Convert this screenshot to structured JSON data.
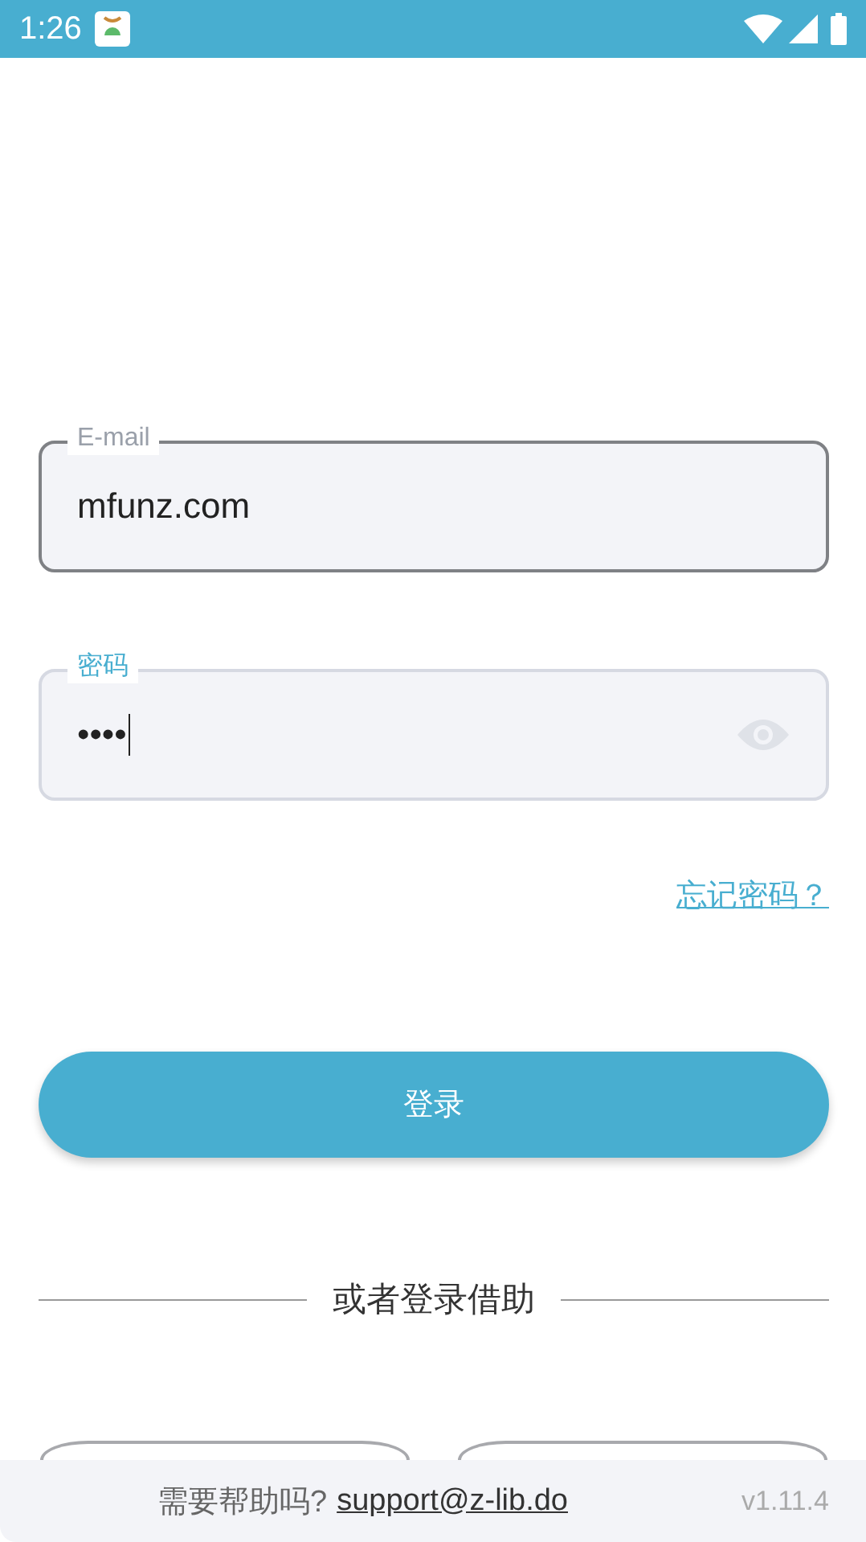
{
  "status_bar": {
    "time": "1:26"
  },
  "fields": [
    {
      "kind": "text",
      "label": "E-mail",
      "value": "mfunz.com",
      "focused": false
    },
    {
      "kind": "password",
      "label": "密码",
      "value": "••••",
      "focused": true
    }
  ],
  "forgot_link": "忘记密码？",
  "login_button": "登录",
  "divider_text": "或者登录借助",
  "alt_buttons": [
    {
      "kind": "empty"
    },
    {
      "kind": "empty"
    }
  ],
  "footer": {
    "help": "需要帮助吗?",
    "email": "support@z-lib.do",
    "version": "v1.11.4"
  }
}
